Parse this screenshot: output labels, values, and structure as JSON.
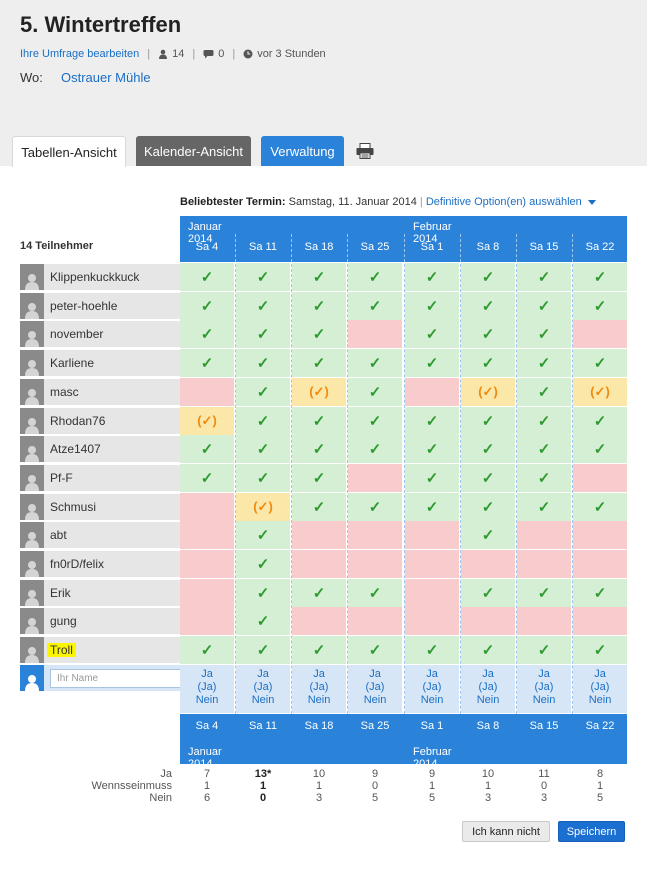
{
  "poll": {
    "title": "5. Wintertreffen",
    "edit_link": "Ihre Umfrage bearbeiten",
    "participants_count": "14",
    "comments_count": "0",
    "updated": "vor 3 Stunden",
    "where_label": "Wo:",
    "where_value": "Ostrauer Mühle"
  },
  "tabs": {
    "table": "Tabellen-Ansicht",
    "calendar": "Kalender-Ansicht",
    "admin": "Verwaltung"
  },
  "popular": {
    "label": "Beliebtester Termin:",
    "value": "Samstag, 11. Januar 2014",
    "separator": "|",
    "link": "Definitive Option(en) auswählen"
  },
  "participants_heading": "14 Teilnehmer",
  "months": [
    "Januar 2014",
    "Februar 2014"
  ],
  "dates": [
    "Sa 4",
    "Sa 11",
    "Sa 18",
    "Sa 25",
    "Sa 1",
    "Sa 8",
    "Sa 15",
    "Sa 22"
  ],
  "participants": [
    {
      "name": "Klippenkuckkuck",
      "votes": [
        "y",
        "y",
        "y",
        "y",
        "y",
        "y",
        "y",
        "y"
      ]
    },
    {
      "name": "peter-hoehle",
      "votes": [
        "y",
        "y",
        "y",
        "y",
        "y",
        "y",
        "y",
        "y"
      ]
    },
    {
      "name": "november",
      "votes": [
        "y",
        "y",
        "y",
        "n",
        "y",
        "y",
        "y",
        "n"
      ]
    },
    {
      "name": "Karliene",
      "votes": [
        "y",
        "y",
        "y",
        "y",
        "y",
        "y",
        "y",
        "y"
      ]
    },
    {
      "name": "masc",
      "votes": [
        "n",
        "y",
        "m",
        "y",
        "n",
        "m",
        "y",
        "m"
      ]
    },
    {
      "name": "Rhodan76",
      "votes": [
        "m",
        "y",
        "y",
        "y",
        "y",
        "y",
        "y",
        "y"
      ]
    },
    {
      "name": "Atze1407",
      "votes": [
        "y",
        "y",
        "y",
        "y",
        "y",
        "y",
        "y",
        "y"
      ]
    },
    {
      "name": "Pf-F",
      "votes": [
        "y",
        "y",
        "y",
        "n",
        "y",
        "y",
        "y",
        "n"
      ]
    },
    {
      "name": "Schmusi",
      "votes": [
        "n",
        "m",
        "y",
        "y",
        "y",
        "y",
        "y",
        "y"
      ]
    },
    {
      "name": "abt",
      "votes": [
        "n",
        "y",
        "n",
        "n",
        "n",
        "y",
        "n",
        "n"
      ]
    },
    {
      "name": "fn0rD/felix",
      "votes": [
        "n",
        "y",
        "n",
        "n",
        "n",
        "n",
        "n",
        "n"
      ]
    },
    {
      "name": "Erik",
      "votes": [
        "n",
        "y",
        "y",
        "y",
        "n",
        "y",
        "y",
        "y"
      ]
    },
    {
      "name": "gung",
      "votes": [
        "n",
        "y",
        "n",
        "n",
        "n",
        "n",
        "n",
        "n"
      ]
    },
    {
      "name": "Troll",
      "votes": [
        "y",
        "y",
        "y",
        "y",
        "y",
        "y",
        "y",
        "y"
      ]
    }
  ],
  "vote_symbols": {
    "yes": "✓",
    "maybe": "(✓)"
  },
  "new_participant": {
    "placeholder": "Ihr Name",
    "options": [
      "Ja",
      "(Ja)",
      "Nein"
    ]
  },
  "totals": {
    "labels": [
      "Ja",
      "Wennsseinmuss",
      "Nein"
    ],
    "ja": [
      "7",
      "13*",
      "10",
      "9",
      "9",
      "10",
      "11",
      "8"
    ],
    "wenn": [
      "1",
      "1",
      "1",
      "0",
      "1",
      "1",
      "0",
      "1"
    ],
    "nein": [
      "6",
      "0",
      "3",
      "5",
      "5",
      "3",
      "3",
      "5"
    ]
  },
  "buttons": {
    "cant": "Ich kann nicht",
    "save": "Speichern"
  },
  "colors": {
    "accent": "#2b82d9",
    "yes_bg": "#d4efd4",
    "no_bg": "#f8cccc",
    "maybe_bg": "#fbe8a8",
    "highlight": "#fbf500"
  },
  "icons": [
    "user-icon",
    "comment-icon",
    "clock-icon",
    "printer-icon",
    "avatar-icon"
  ]
}
